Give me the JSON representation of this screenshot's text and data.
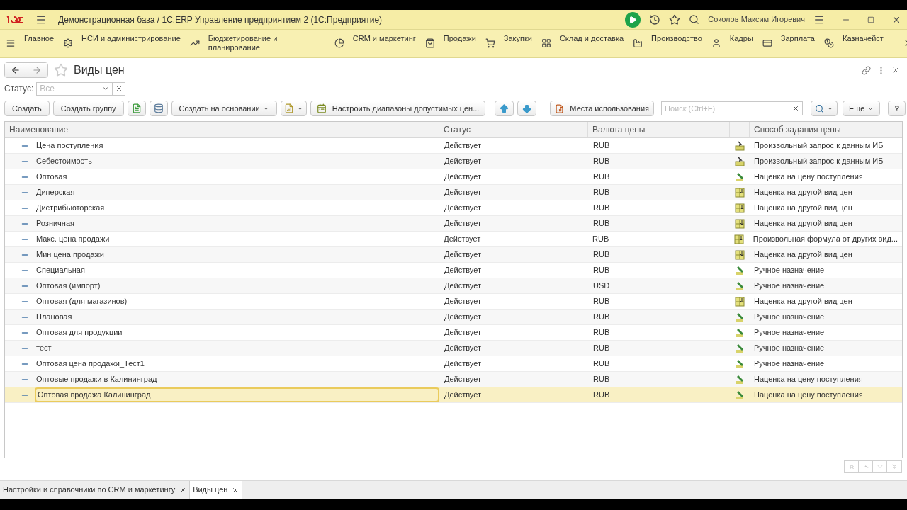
{
  "window": {
    "title": "Демонстрационная база / 1С:ERP Управление предприятием 2  (1С:Предприятие)",
    "user": "Соколов Максим Игоревич"
  },
  "sections": [
    {
      "label": "Главное"
    },
    {
      "label": "НСИ и администрирование"
    },
    {
      "label": "Бюджетирование и планирование"
    },
    {
      "label": "CRM и маркетинг"
    },
    {
      "label": "Продажи"
    },
    {
      "label": "Закупки"
    },
    {
      "label": "Склад и доставка"
    },
    {
      "label": "Производство"
    },
    {
      "label": "Кадры"
    },
    {
      "label": "Зарплата"
    },
    {
      "label": "Казначейст"
    }
  ],
  "form": {
    "title": "Виды цен",
    "filter_label": "Статус:",
    "filter_placeholder": "Все",
    "search_placeholder": "Поиск (Ctrl+F)"
  },
  "toolbar": [
    {
      "kind": "text",
      "label": "Создать"
    },
    {
      "kind": "text",
      "label": "Создать группу"
    },
    {
      "kind": "copy"
    },
    {
      "kind": "list"
    },
    {
      "kind": "dropdown",
      "label": "Создать на основании"
    },
    {
      "kind": "report"
    },
    {
      "kind": "range",
      "label": "Настроить диапазоны допустимых цен..."
    },
    {
      "kind": "up"
    },
    {
      "kind": "down"
    },
    {
      "kind": "usage",
      "label": "Места использования"
    }
  ],
  "more_label": "Еще",
  "help_label": "?",
  "table": {
    "columns": [
      "Наименование",
      "Статус",
      "Валюта цены",
      "Способ задания цены"
    ],
    "rows": [
      {
        "name": "Цена поступления",
        "status": "Действует",
        "currency": "RUB",
        "method": "Произвольный запрос к данным ИБ",
        "kind": "query",
        "selected": false
      },
      {
        "name": "Себестоимость",
        "status": "Действует",
        "currency": "RUB",
        "method": "Произвольный запрос к данным ИБ",
        "kind": "query",
        "selected": false
      },
      {
        "name": "Оптовая",
        "status": "Действует",
        "currency": "RUB",
        "method": "Наценка на цену поступления",
        "kind": "manual",
        "selected": false
      },
      {
        "name": "Диперская",
        "status": "Действует",
        "currency": "RUB",
        "method": "Наценка на другой вид цен",
        "kind": "formula",
        "selected": false
      },
      {
        "name": "Дистрибьюторская",
        "status": "Действует",
        "currency": "RUB",
        "method": "Наценка на другой вид цен",
        "kind": "formula",
        "selected": false
      },
      {
        "name": "Розничная",
        "status": "Действует",
        "currency": "RUB",
        "method": "Наценка на другой вид цен",
        "kind": "formula",
        "selected": false
      },
      {
        "name": "Макс. цена продажи",
        "status": "Действует",
        "currency": "RUB",
        "method": "Произвольная формула от других вид...",
        "kind": "formula",
        "selected": false
      },
      {
        "name": "Мин цена продажи",
        "status": "Действует",
        "currency": "RUB",
        "method": "Наценка на другой вид цен",
        "kind": "formula",
        "selected": false
      },
      {
        "name": "Специальная",
        "status": "Действует",
        "currency": "RUB",
        "method": "Ручное назначение",
        "kind": "manual",
        "selected": false
      },
      {
        "name": "Оптовая (импорт)",
        "status": "Действует",
        "currency": "USD",
        "method": "Ручное назначение",
        "kind": "manual",
        "selected": false
      },
      {
        "name": "Оптовая (для магазинов)",
        "status": "Действует",
        "currency": "RUB",
        "method": "Наценка на другой вид цен",
        "kind": "formula",
        "selected": false
      },
      {
        "name": "Плановая",
        "status": "Действует",
        "currency": "RUB",
        "method": "Ручное назначение",
        "kind": "manual",
        "selected": false
      },
      {
        "name": "Оптовая для продукции",
        "status": "Действует",
        "currency": "RUB",
        "method": "Ручное назначение",
        "kind": "manual",
        "selected": false
      },
      {
        "name": "тест",
        "status": "Действует",
        "currency": "RUB",
        "method": "Ручное назначение",
        "kind": "manual",
        "selected": false
      },
      {
        "name": "Оптовая цена продажи_Тест1",
        "status": "Действует",
        "currency": "RUB",
        "method": "Ручное назначение",
        "kind": "manual",
        "selected": false
      },
      {
        "name": "Оптовые продажи в Калининград",
        "status": "Действует",
        "currency": "RUB",
        "method": "Наценка на цену поступления",
        "kind": "manual",
        "selected": false
      },
      {
        "name": "Оптовая продажа Калининград",
        "status": "Действует",
        "currency": "RUB",
        "method": "Наценка на цену поступления",
        "kind": "manual",
        "selected": true
      }
    ]
  },
  "open_tabs": [
    {
      "label": "Настройки и справочники по CRM и маркетингу",
      "selected": false
    },
    {
      "label": "Виды цен",
      "selected": true
    }
  ]
}
